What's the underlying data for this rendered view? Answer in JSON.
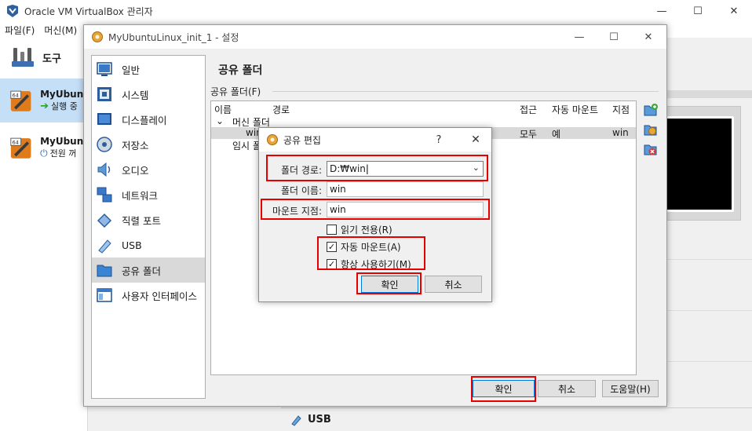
{
  "manager": {
    "title": "Oracle VM VirtualBox 관리자",
    "menu": [
      "파일(F)",
      "머신(M)"
    ],
    "tools_label": "도구",
    "vms": [
      {
        "name": "MyUbunt",
        "state": "실행 중",
        "selected": true
      },
      {
        "name": "MyUbunt",
        "state": "전원 꺼",
        "selected": false
      }
    ],
    "usb_label": "USB"
  },
  "settings": {
    "title": "MyUbuntuLinux_init_1 - 설정",
    "categories": [
      {
        "label": "일반",
        "icon": "general-icon"
      },
      {
        "label": "시스템",
        "icon": "system-icon"
      },
      {
        "label": "디스플레이",
        "icon": "display-icon"
      },
      {
        "label": "저장소",
        "icon": "storage-icon"
      },
      {
        "label": "오디오",
        "icon": "audio-icon"
      },
      {
        "label": "네트워크",
        "icon": "network-icon"
      },
      {
        "label": "직렬 포트",
        "icon": "serial-port-icon"
      },
      {
        "label": "USB",
        "icon": "usb-icon"
      },
      {
        "label": "공유 폴더",
        "icon": "shared-folder-icon",
        "selected": true
      },
      {
        "label": "사용자 인터페이스",
        "icon": "user-interface-icon"
      }
    ],
    "section_title": "공유 폴더",
    "group_label": "공유 폴더(F)",
    "columns": [
      "이름",
      "경로",
      "접근",
      "자동 마운트",
      "지점"
    ],
    "tree": {
      "machine_folders": "머신 폴더",
      "row": {
        "name": "win",
        "access": "모두",
        "auto_mount": "예",
        "mount_point": "win"
      },
      "transient_folders": "임시 폴더"
    },
    "buttons": {
      "ok": "확인",
      "cancel": "취소",
      "help": "도움말(H)"
    }
  },
  "share_dialog": {
    "title": "공유 편집",
    "help": "?",
    "folder_path_label": "폴더 경로:",
    "folder_path_value": "D:₩win",
    "folder_name_label": "폴더 이름:",
    "folder_name_value": "win",
    "mount_point_label": "마운트 지점:",
    "mount_point_value": "win",
    "read_only": {
      "label": "읽기 전용(R)",
      "checked": false
    },
    "auto_mount": {
      "label": "자동 마운트(A)",
      "checked": true
    },
    "permanent": {
      "label": "항상 사용하기(M)",
      "checked": true
    },
    "ok": "확인",
    "cancel": "취소"
  },
  "colors": {
    "highlight": "#e60000",
    "selection": "#c5dff7",
    "accent": "#0078d7"
  }
}
